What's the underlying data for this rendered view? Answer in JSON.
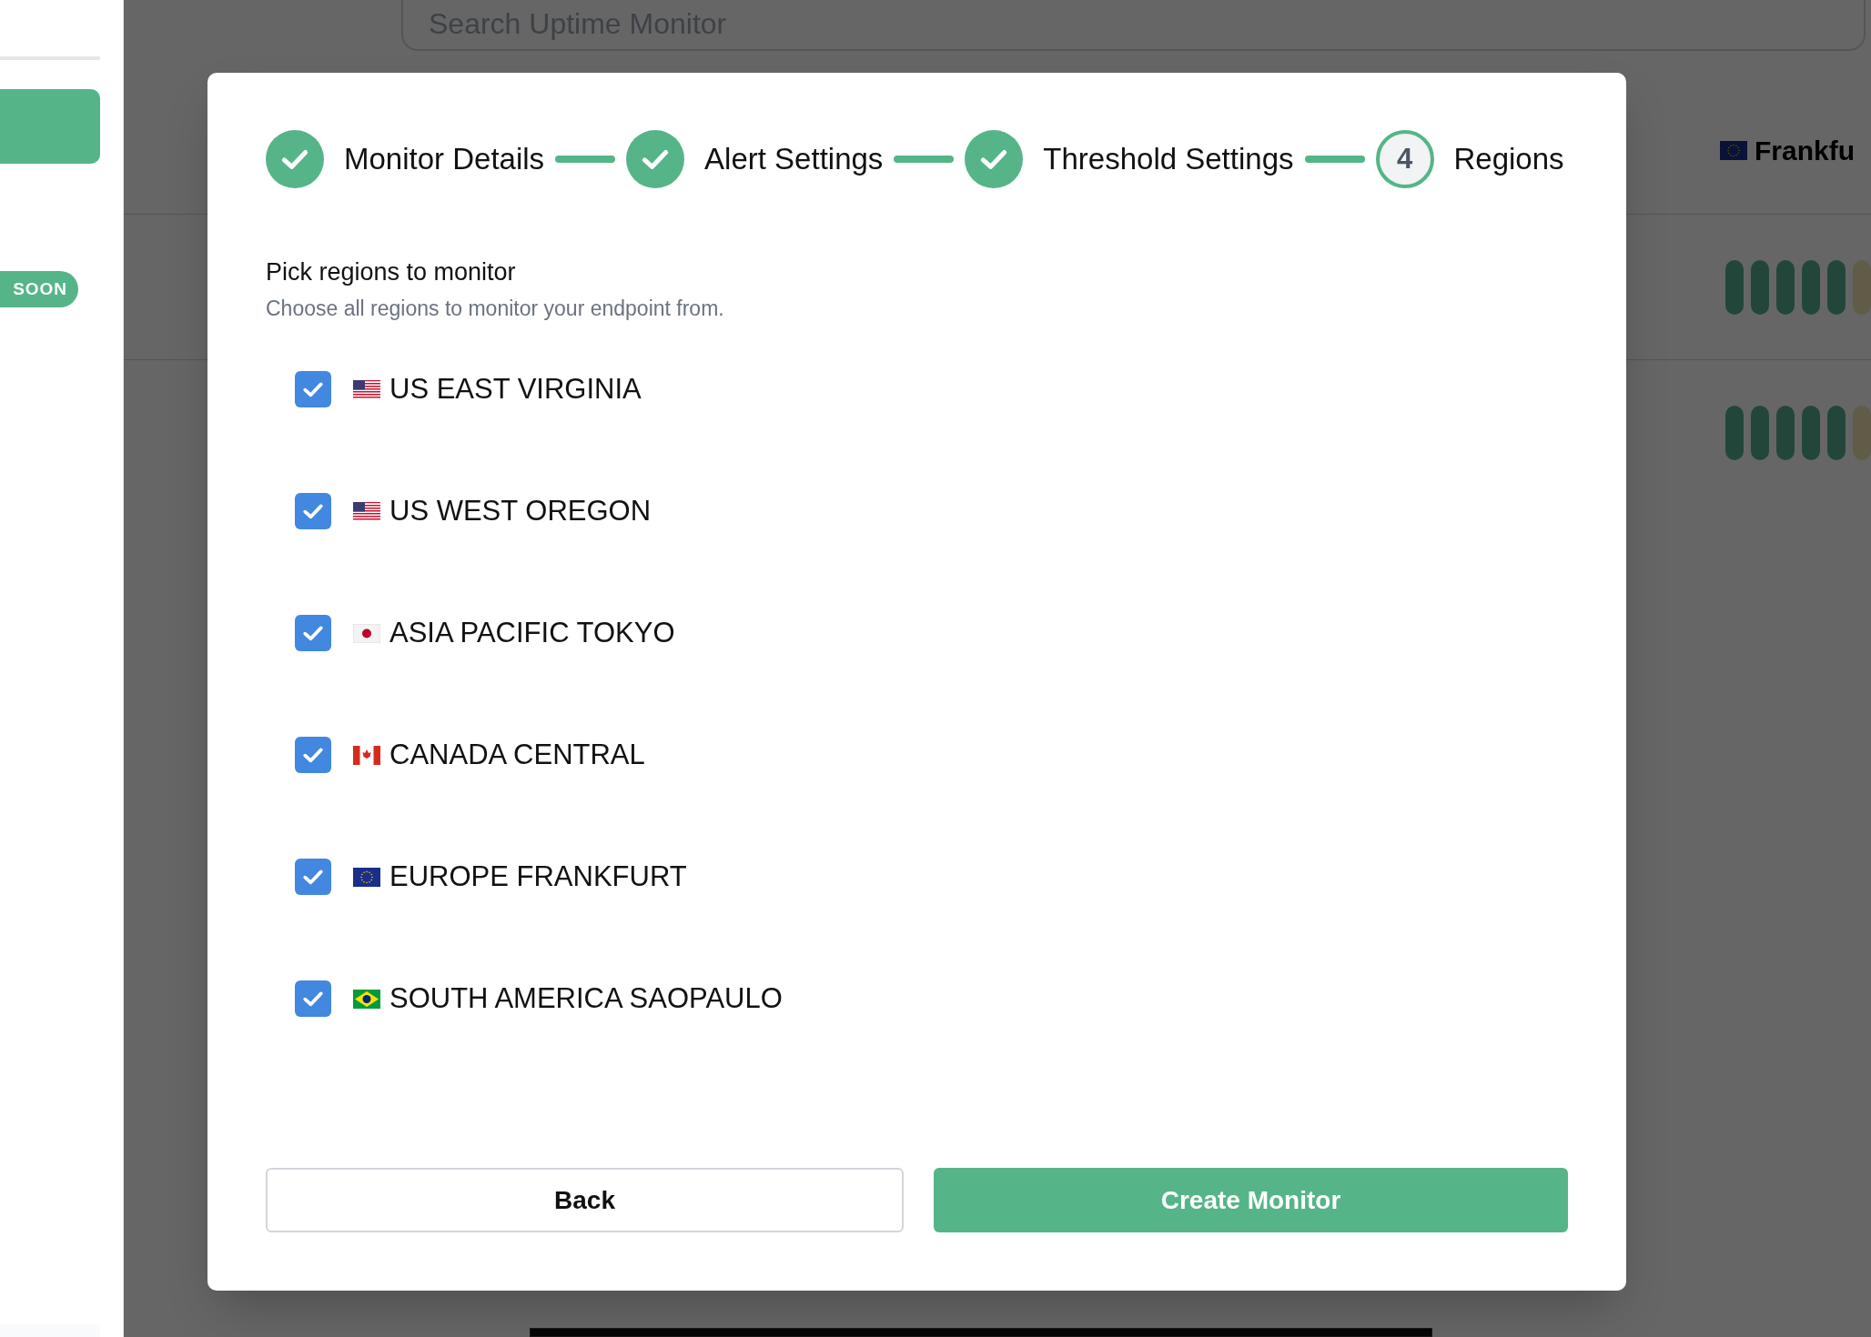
{
  "sidebar": {
    "badge": "SOON"
  },
  "search": {
    "placeholder": "Search Uptime Monitor"
  },
  "table": {
    "header": {
      "kind": "eu",
      "label": "Frankfu"
    }
  },
  "dialog": {
    "steps": [
      {
        "kind": "done",
        "label": "Monitor Details"
      },
      {
        "kind": "done",
        "label": "Alert Settings"
      },
      {
        "kind": "done",
        "label": "Threshold Settings"
      },
      {
        "kind": "current",
        "number": "4",
        "label": "Regions"
      }
    ],
    "heading": "Pick regions to monitor",
    "subheading": "Choose all regions to monitor your endpoint from.",
    "regions": [
      {
        "kind": "us",
        "label": "US EAST VIRGINIA",
        "checked": true
      },
      {
        "kind": "us",
        "label": "US WEST OREGON",
        "checked": true
      },
      {
        "kind": "jp",
        "label": "ASIA PACIFIC TOKYO",
        "checked": true
      },
      {
        "kind": "ca",
        "label": "CANADA CENTRAL",
        "checked": true
      },
      {
        "kind": "eu",
        "label": "EUROPE FRANKFURT",
        "checked": true
      },
      {
        "kind": "br",
        "label": "SOUTH AMERICA SAOPAULO",
        "checked": true
      }
    ],
    "buttons": [
      {
        "kind": "secondary",
        "label": "Back"
      },
      {
        "kind": "primary",
        "label": "Create Monitor"
      }
    ]
  }
}
